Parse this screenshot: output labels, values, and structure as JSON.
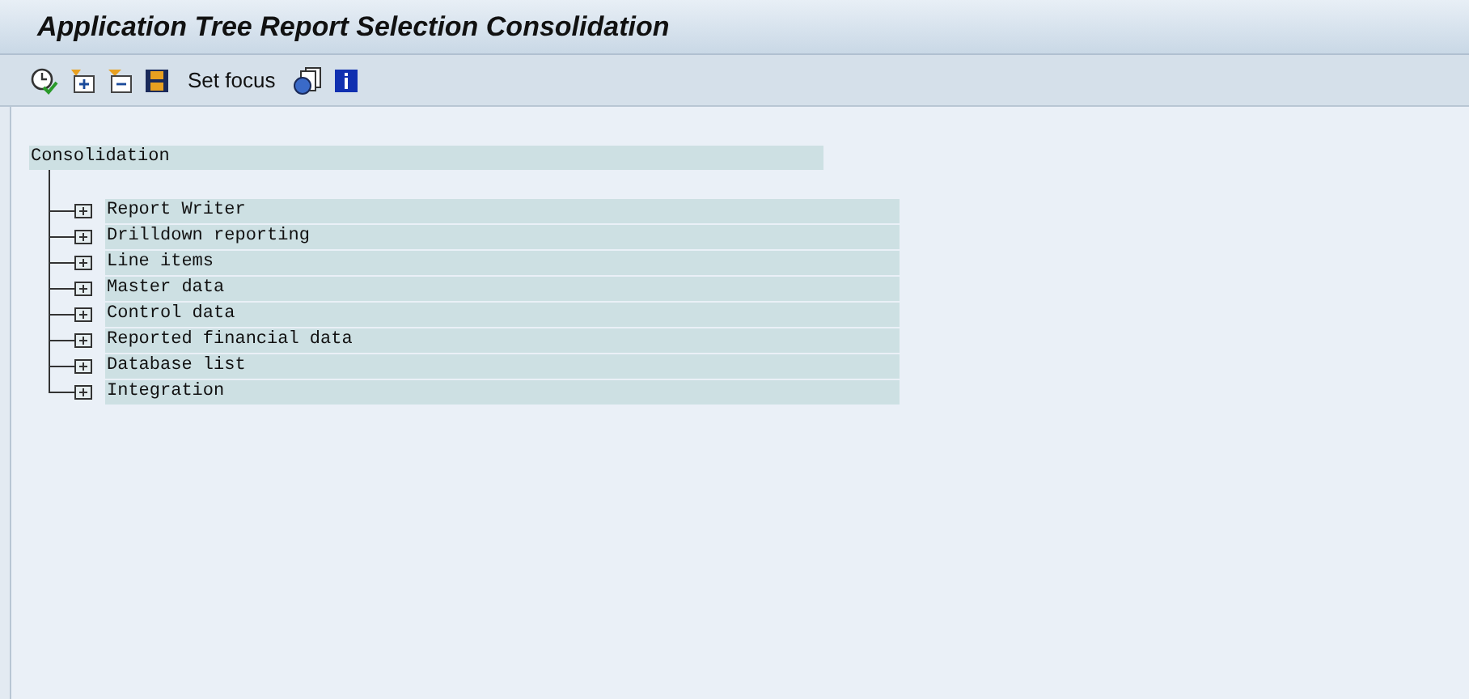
{
  "window": {
    "title": "Application Tree Report Selection Consolidation"
  },
  "toolbar": {
    "focus_button": "Set focus"
  },
  "tree": {
    "label": "Consolidation",
    "children": [
      {
        "label": "Report Writer",
        "expanded": false
      },
      {
        "label": "Drilldown reporting",
        "expanded": false
      },
      {
        "label": "Line items",
        "expanded": false
      },
      {
        "label": "Master data",
        "expanded": false
      },
      {
        "label": "Control data",
        "expanded": false
      },
      {
        "label": "Reported financial data",
        "expanded": false
      },
      {
        "label": "Database list",
        "expanded": false
      },
      {
        "label": "Integration",
        "expanded": false
      }
    ]
  }
}
